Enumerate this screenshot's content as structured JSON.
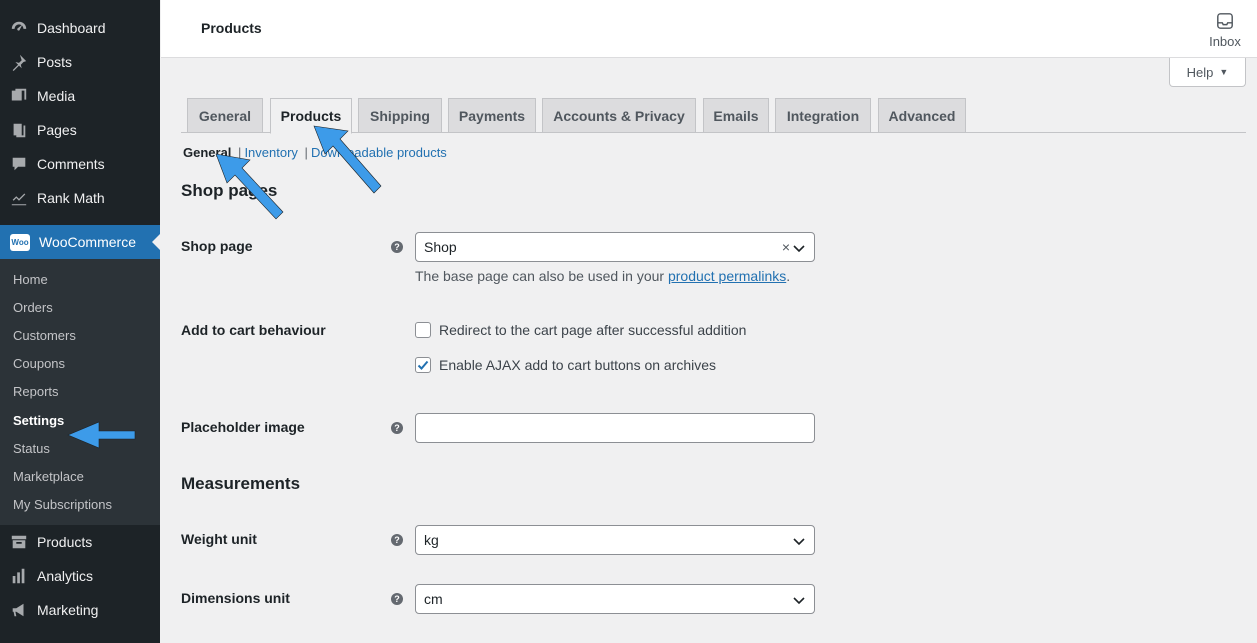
{
  "sidebar": {
    "items": [
      {
        "label": "Dashboard",
        "icon": "dashboard-icon"
      },
      {
        "label": "Posts",
        "icon": "pin-icon"
      },
      {
        "label": "Media",
        "icon": "media-icon"
      },
      {
        "label": "Pages",
        "icon": "pages-icon"
      },
      {
        "label": "Comments",
        "icon": "comment-icon"
      },
      {
        "label": "Rank Math",
        "icon": "chart-icon"
      }
    ],
    "woocommerce": {
      "label": "WooCommerce",
      "icon_text": "Woo"
    },
    "submenu": [
      "Home",
      "Orders",
      "Customers",
      "Coupons",
      "Reports",
      "Settings",
      "Status",
      "Marketplace",
      "My Subscriptions"
    ],
    "bottom_items": [
      {
        "label": "Products",
        "icon": "archive-icon"
      },
      {
        "label": "Analytics",
        "icon": "bar-chart-icon"
      },
      {
        "label": "Marketing",
        "icon": "megaphone-icon"
      }
    ]
  },
  "header": {
    "title": "Products",
    "inbox_label": "Inbox"
  },
  "help": {
    "label": "Help",
    "caret": "▼"
  },
  "tabs": [
    "General",
    "Products",
    "Shipping",
    "Payments",
    "Accounts & Privacy",
    "Emails",
    "Integration",
    "Advanced"
  ],
  "subsub": {
    "current": "General",
    "links": [
      "Inventory",
      "Downloadable products"
    ],
    "separator": "|"
  },
  "sections": {
    "shop_pages": "Shop pages",
    "measurements": "Measurements"
  },
  "fields": {
    "shop_page": {
      "label": "Shop page",
      "value": "Shop",
      "clear": "×",
      "help": "?"
    },
    "shop_desc": {
      "before": "The base page can also be used in your ",
      "link": "product permalinks",
      "after": "."
    },
    "add_to_cart": {
      "label": "Add to cart behaviour",
      "options": [
        {
          "label": "Redirect to the cart page after successful addition",
          "checked": false
        },
        {
          "label": "Enable AJAX add to cart buttons on archives",
          "checked": true
        }
      ]
    },
    "placeholder_image": {
      "label": "Placeholder image",
      "value": "",
      "help": "?"
    },
    "weight_unit": {
      "label": "Weight unit",
      "value": "kg",
      "help": "?"
    },
    "dimensions_unit": {
      "label": "Dimensions unit",
      "value": "cm",
      "help": "?"
    }
  },
  "colors": {
    "accent": "#2271b1",
    "sidebar": "#1d2327",
    "annotation_arrow": "#3d9be9"
  }
}
